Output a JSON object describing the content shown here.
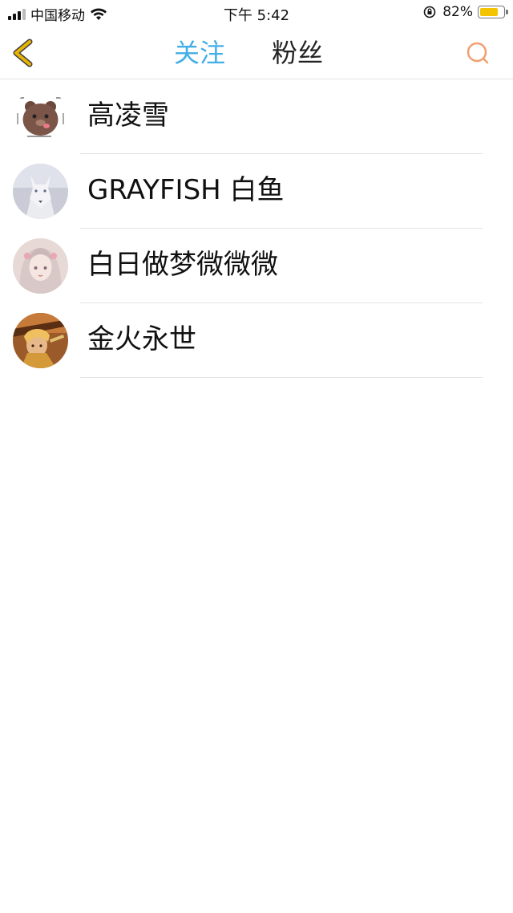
{
  "status_bar": {
    "carrier": "中国移动",
    "time": "下午 5:42",
    "battery": "82%",
    "battery_level": 0.82,
    "battery_color": "#f5c400",
    "icons": [
      "signal-icon",
      "wifi-icon",
      "orientation-lock-icon",
      "battery-icon"
    ]
  },
  "nav": {
    "back_icon": "chevron-left-icon",
    "tabs": [
      {
        "label": "关注",
        "active": true
      },
      {
        "label": "粉丝",
        "active": false
      }
    ],
    "search_icon": "search-icon",
    "active_color": "#43aee6",
    "search_color": "#f0a070",
    "back_color": "#e8b400"
  },
  "list": {
    "items": [
      {
        "name": "高凌雪",
        "avatar": "bear-meme-avatar"
      },
      {
        "name": "GRAYFISH 白鱼",
        "avatar": "white-wolf-avatar"
      },
      {
        "name": "白日做梦微微微",
        "avatar": "anime-girl-avatar"
      },
      {
        "name": "金火永世",
        "avatar": "warrior-avatar"
      }
    ]
  }
}
